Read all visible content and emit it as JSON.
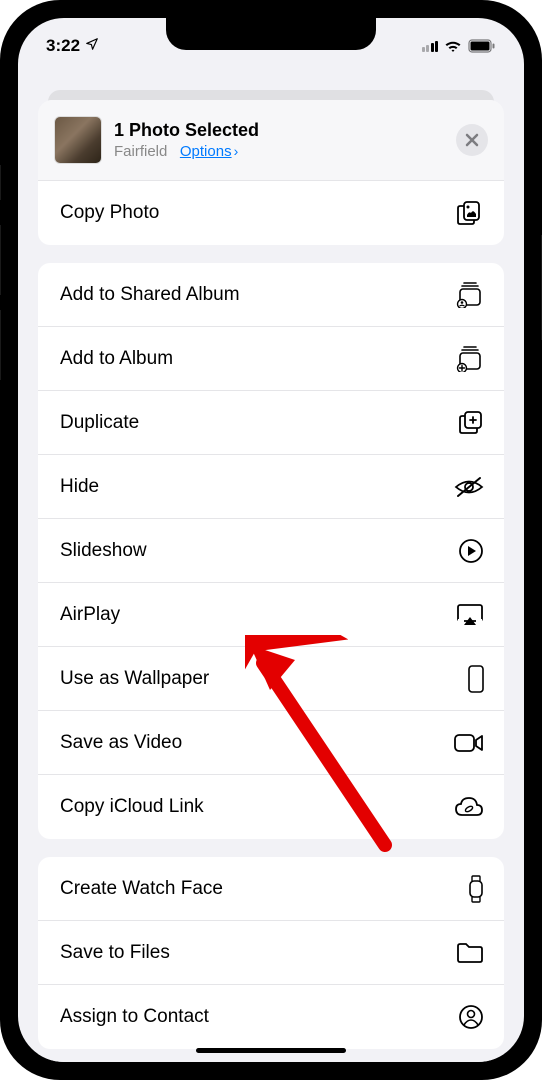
{
  "status": {
    "time": "3:22",
    "locationIcon": "location-arrow"
  },
  "sheet": {
    "title": "1 Photo Selected",
    "subtitle": "Fairfield",
    "optionsLabel": "Options"
  },
  "groups": [
    {
      "items": [
        {
          "label": "Copy Photo",
          "icon": "copy-photo",
          "name": "copy-photo-row"
        }
      ]
    },
    {
      "items": [
        {
          "label": "Add to Shared Album",
          "icon": "shared-album",
          "name": "add-shared-album-row"
        },
        {
          "label": "Add to Album",
          "icon": "add-album",
          "name": "add-album-row"
        },
        {
          "label": "Duplicate",
          "icon": "duplicate",
          "name": "duplicate-row"
        },
        {
          "label": "Hide",
          "icon": "hide",
          "name": "hide-row"
        },
        {
          "label": "Slideshow",
          "icon": "slideshow",
          "name": "slideshow-row"
        },
        {
          "label": "AirPlay",
          "icon": "airplay",
          "name": "airplay-row"
        },
        {
          "label": "Use as Wallpaper",
          "icon": "wallpaper",
          "name": "use-wallpaper-row"
        },
        {
          "label": "Save as Video",
          "icon": "video",
          "name": "save-video-row"
        },
        {
          "label": "Copy iCloud Link",
          "icon": "icloud-link",
          "name": "icloud-link-row"
        }
      ]
    },
    {
      "items": [
        {
          "label": "Create Watch Face",
          "icon": "watch",
          "name": "watch-face-row"
        },
        {
          "label": "Save to Files",
          "icon": "folder",
          "name": "save-files-row"
        },
        {
          "label": "Assign to Contact",
          "icon": "contact",
          "name": "assign-contact-row"
        }
      ]
    }
  ]
}
